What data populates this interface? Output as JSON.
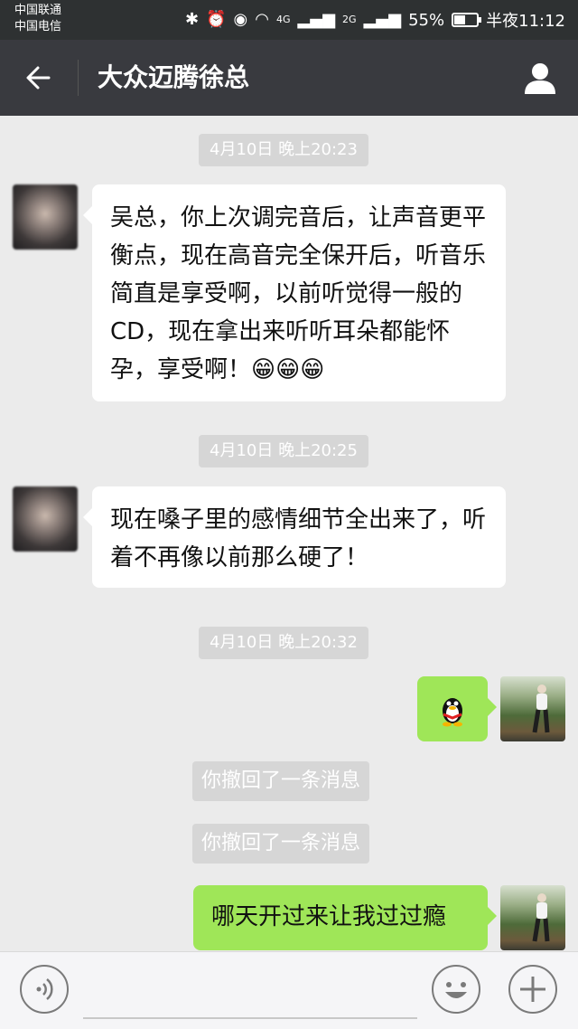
{
  "status": {
    "carrier1": "中国联通",
    "carrier2": "中国电信",
    "signal1": "4G",
    "signal2": "2G",
    "battery_percent": "55%",
    "battery_level": 0.55,
    "time": "半夜11:12"
  },
  "header": {
    "title": "大众迈腾徐总"
  },
  "messages": [
    {
      "time": "4月10日 晚上20:23"
    },
    {
      "text": "吴总，你上次调完音后，让声音更平衡点，现在高音完全保开后，听音乐简直是享受啊，以前听觉得一般的CD，现在拿出来听听耳朵都能怀孕，享受啊！",
      "emoji": "😁😁😁"
    },
    {
      "time": "4月10日 晚上20:25"
    },
    {
      "text": "现在嗓子里的感情细节全出来了，听着不再像以前那么硬了！"
    },
    {
      "time": "4月10日 晚上20:32"
    },
    {
      "recall1": "你撤回了一条消息",
      "recall2": "你撤回了一条消息"
    },
    {
      "text": "哪天开过来让我过过瘾"
    }
  ],
  "colors": {
    "title_bar": "#393a3f",
    "status_bar": "#2e3132",
    "sent_bubble": "#9fe658",
    "chat_bg": "#ebebeb"
  }
}
